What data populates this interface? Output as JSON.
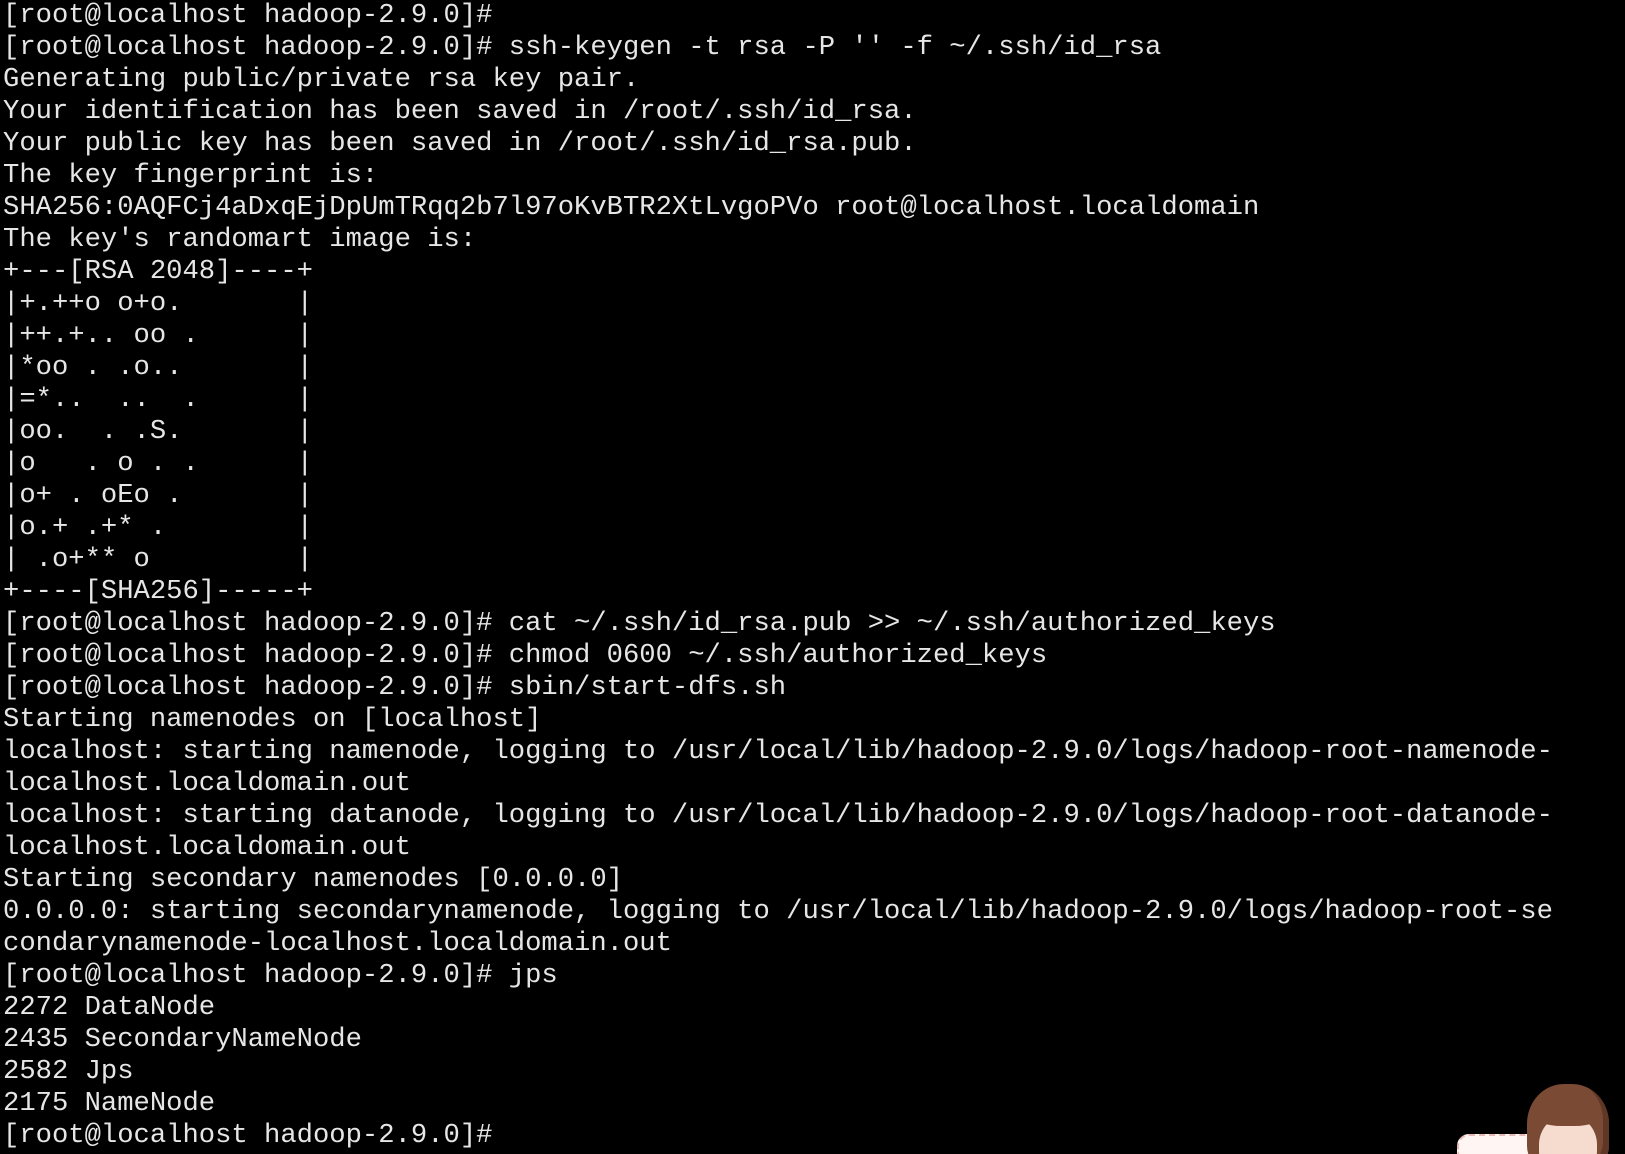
{
  "terminal": {
    "lines": [
      "[root@localhost hadoop-2.9.0]#",
      "[root@localhost hadoop-2.9.0]# ssh-keygen -t rsa -P '' -f ~/.ssh/id_rsa",
      "Generating public/private rsa key pair.",
      "Your identification has been saved in /root/.ssh/id_rsa.",
      "Your public key has been saved in /root/.ssh/id_rsa.pub.",
      "The key fingerprint is:",
      "SHA256:0AQFCj4aDxqEjDpUmTRqq2b7l97oKvBTR2XtLvgoPVo root@localhost.localdomain",
      "The key's randomart image is:",
      "+---[RSA 2048]----+",
      "|+.++o o+o.       |",
      "|++.+.. oo .      |",
      "|*oo . .o..       |",
      "|=*..  ..  .      |",
      "|oo.  . .S.       |",
      "|o   . o . .      |",
      "|o+ . oEo .       |",
      "|o.+ .+* .        |",
      "| .o+** o         |",
      "+----[SHA256]-----+",
      "[root@localhost hadoop-2.9.0]# cat ~/.ssh/id_rsa.pub >> ~/.ssh/authorized_keys",
      "[root@localhost hadoop-2.9.0]# chmod 0600 ~/.ssh/authorized_keys",
      "[root@localhost hadoop-2.9.0]# sbin/start-dfs.sh",
      "Starting namenodes on [localhost]",
      "localhost: starting namenode, logging to /usr/local/lib/hadoop-2.9.0/logs/hadoop-root-namenode-",
      "localhost.localdomain.out",
      "localhost: starting datanode, logging to /usr/local/lib/hadoop-2.9.0/logs/hadoop-root-datanode-",
      "localhost.localdomain.out",
      "Starting secondary namenodes [0.0.0.0]",
      "0.0.0.0: starting secondarynamenode, logging to /usr/local/lib/hadoop-2.9.0/logs/hadoop-root-se",
      "condarynamenode-localhost.localdomain.out",
      "[root@localhost hadoop-2.9.0]# jps",
      "2272 DataNode",
      "2435 SecondaryNameNode",
      "2582 Jps",
      "2175 NameNode",
      "[root@localhost hadoop-2.9.0]#"
    ]
  },
  "colors": {
    "background": "#000000",
    "foreground": "#e6e6e6"
  },
  "overlay": {
    "icon": "anime-girl-mascot-icon"
  }
}
